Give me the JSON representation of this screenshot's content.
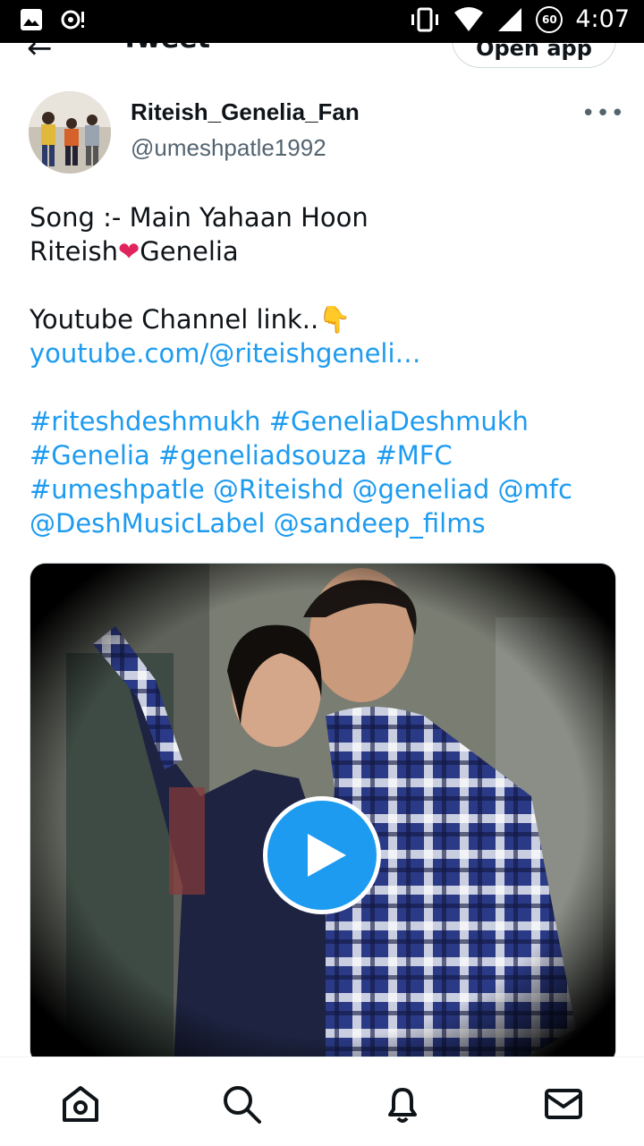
{
  "status_bar": {
    "time": "4:07",
    "badge": "60",
    "icons": [
      "image-icon",
      "sync-icon",
      "vibrate-icon",
      "wifi-icon",
      "signal-icon",
      "data-saver-icon"
    ]
  },
  "header": {
    "title": "Tweet",
    "open_app_label": "Open app"
  },
  "tweet": {
    "author": {
      "display_name": "Riteish_Genelia_Fan",
      "handle": "@umeshpatle1992"
    },
    "more_label": "•••",
    "text": {
      "line1": "Song :- Main Yahaan Hoon",
      "line2_a": "Riteish",
      "line2_heart": "❤",
      "line2_b": "Genelia",
      "line3": "Youtube Channel link..",
      "line3_emoji": "👇",
      "link": "youtube.com/@riteishgeneli…",
      "hashtags_line1": "#riteshdeshmukh #GeneliaDeshmukh",
      "hashtags_line2": "#Genelia #geneliadsouza #MFC",
      "hashtags_line3": "#umeshpatle @Riteishd @geneliad @mfc",
      "hashtags_line4": "@DeshMusicLabel @sandeep_films"
    }
  },
  "bottom_nav": [
    "home-icon",
    "search-icon",
    "notifications-icon",
    "messages-icon"
  ],
  "colors": {
    "accent": "#1d9bf0",
    "text": "#0f1419",
    "secondary": "#536471",
    "heart": "#e0245e"
  }
}
